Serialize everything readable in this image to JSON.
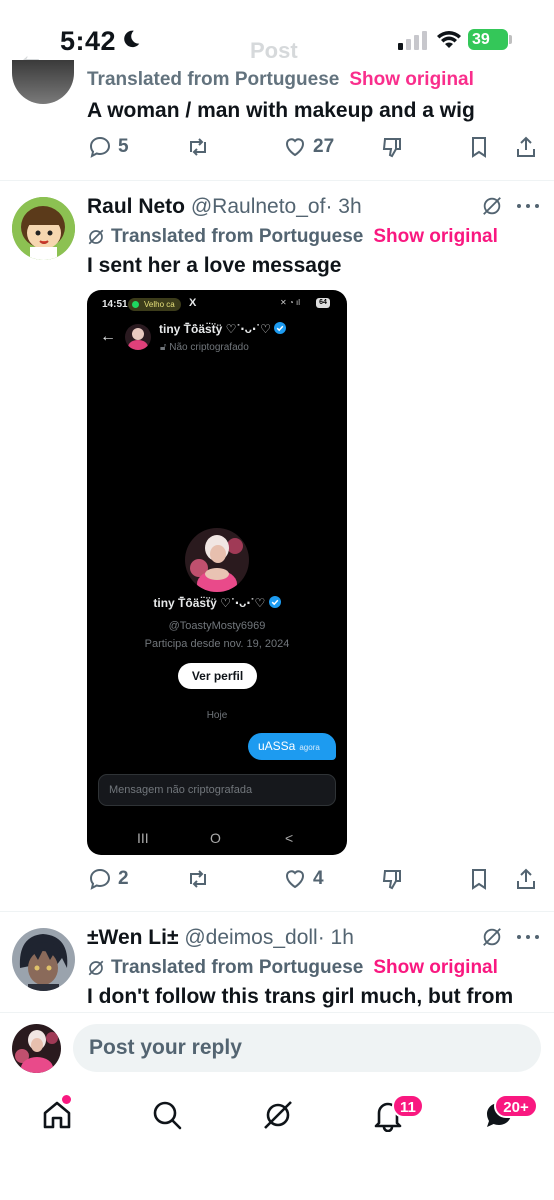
{
  "status_bar": {
    "time": "5:42",
    "battery": "39"
  },
  "background_header": {
    "title": "Post"
  },
  "tweet0": {
    "translated_label": "Translated from Portuguese",
    "show_original": "Show original",
    "text": "A woman / man with makeup and a wig",
    "replies": "5",
    "likes": "27"
  },
  "tweet1": {
    "name": "Raul Neto",
    "handle": "@Raulneto_of",
    "time": "· 3h",
    "translated_label": "Translated from Portuguese",
    "show_original": "Show original",
    "text": "I sent her a love message",
    "replies": "2",
    "likes": "4",
    "screenshot": {
      "time": "14:51",
      "spotify_label": "Velho ca",
      "x_label": "X",
      "battery": "64",
      "name": "tiny Ṫ̈ỏ̈ä̈s̈ẗÿ ♡˙‧ᴗ‧˙♡",
      "encryption": "Não criptografado",
      "profile_handle": "@ToastyMosty6969",
      "joined": "Participa desde nov. 19, 2024",
      "view_profile": "Ver perfil",
      "today": "Hoje",
      "message": "uASSa",
      "message_time": "agora",
      "input_placeholder": "Mensagem não criptografada",
      "nav_recent": "III",
      "nav_home": "O",
      "nav_back": "<"
    }
  },
  "tweet2": {
    "name": "±Wen Li±",
    "handle": "@deimos_doll",
    "time": "· 1h",
    "translated_label": "Translated from Portuguese",
    "show_original": "Show original",
    "text": "I don't follow this trans girl much, but from"
  },
  "reply_bar": {
    "placeholder": "Post your reply"
  },
  "tab_bar": {
    "notifications_badge": "11",
    "messages_badge": "20+"
  },
  "colors": {
    "accent": "#f91880",
    "blue": "#1d9bf0",
    "muted": "#536471"
  }
}
